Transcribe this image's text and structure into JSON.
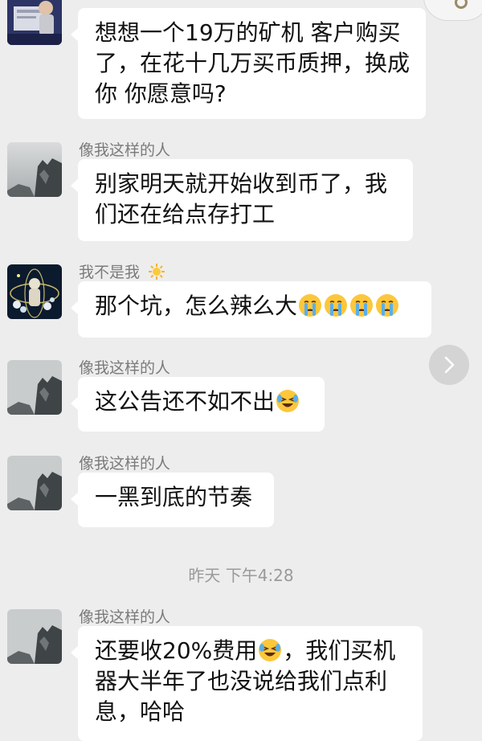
{
  "messages": [
    {
      "sender": "",
      "text": "想想一个19万的矿机 客户购买了，在花十几万买币质押，换成你 你愿意吗?"
    },
    {
      "sender": "像我这样的人",
      "text": "别家明天就开始收到币了，我们还在给点存打工"
    },
    {
      "sender": "我不是我",
      "sender_emoji": "sun-emoji",
      "text": "那个坑，怎么辣么大",
      "emojis": [
        "crying-face-emoji",
        "crying-face-emoji",
        "crying-face-emoji",
        "crying-face-emoji"
      ]
    },
    {
      "sender": "像我这样的人",
      "text": "这公告还不如不出",
      "emojis": [
        "laughing-crying-face-emoji"
      ]
    },
    {
      "sender": "像我这样的人",
      "text": "一黑到底的节奏"
    },
    {
      "sender": "像我这样的人",
      "text_before": "还要收20%费用",
      "emojis": [
        "laughing-crying-face-emoji"
      ],
      "text_after": "，我们买机器大半年了也没说给我们点利息，哈哈"
    }
  ],
  "timestamp": "昨天 下午4:28",
  "controls": {
    "next_icon": "chevron-right-icon",
    "corner_icon": "circle-icon"
  },
  "colors": {
    "background": "#ededed",
    "bubble": "#ffffff",
    "sender_name": "#7b7b7b",
    "timestamp": "#9a9a9a"
  }
}
